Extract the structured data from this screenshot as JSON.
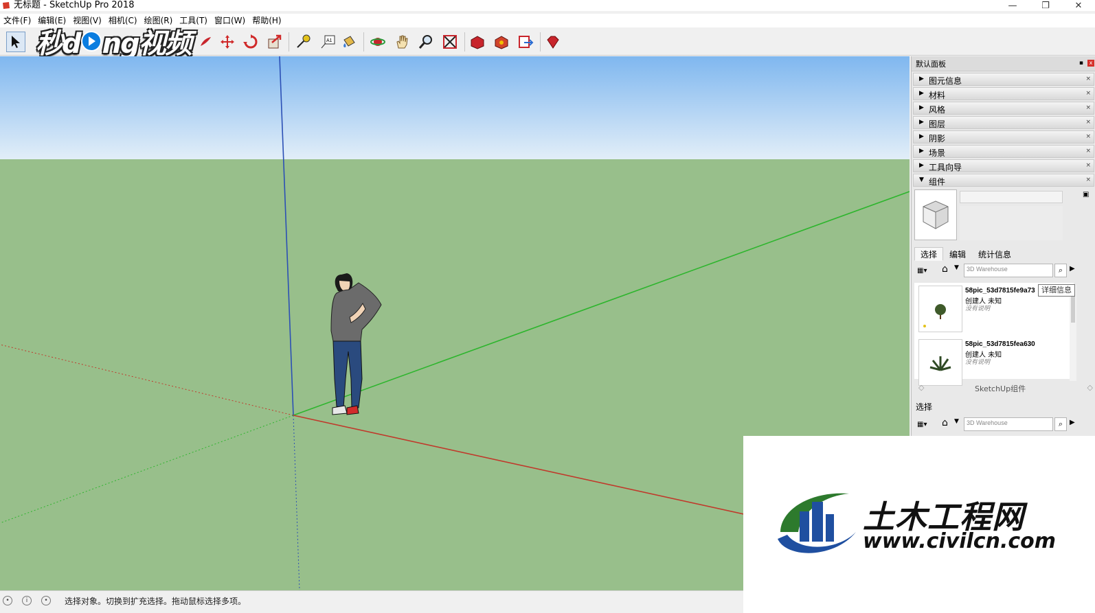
{
  "window": {
    "title": "无标题 - SketchUp Pro 2018",
    "min_glyph": "—",
    "restore_glyph": "❐",
    "close_glyph": "✕"
  },
  "menu": [
    "文件(F)",
    "编辑(E)",
    "视图(V)",
    "相机(C)",
    "绘图(R)",
    "工具(T)",
    "窗口(W)",
    "帮助(H)"
  ],
  "watermark_top": {
    "part1": "秒d",
    "part2": "ng视频"
  },
  "toolbar_icons": [
    "select-icon",
    "paint-icon",
    "move-icon",
    "rotate-icon",
    "push-pull-icon",
    "tape-measure-icon",
    "text-icon",
    "paint-bucket-icon",
    "orbit-icon",
    "pan-icon",
    "zoom-icon",
    "zoom-extents-icon",
    "warehouse-icon",
    "extension-warehouse-icon",
    "send-to-layout-icon",
    "ruby-icon"
  ],
  "panel": {
    "title": "默认面板",
    "trays": [
      {
        "label": "图元信息",
        "expanded": false
      },
      {
        "label": "材料",
        "expanded": false
      },
      {
        "label": "风格",
        "expanded": false
      },
      {
        "label": "图层",
        "expanded": false
      },
      {
        "label": "阴影",
        "expanded": false
      },
      {
        "label": "场景",
        "expanded": false
      },
      {
        "label": "工具向导",
        "expanded": false
      },
      {
        "label": "组件",
        "expanded": true
      }
    ],
    "tabs": [
      "选择",
      "编辑",
      "统计信息"
    ],
    "search_placeholder": "3D Warehouse",
    "tooltip": "详细信息",
    "results": [
      {
        "name": "58pic_53d7815fe9a73",
        "author": "创建人 未知",
        "desc": "没有说明"
      },
      {
        "name": "58pic_53d7815fea630",
        "author": "创建人 未知",
        "desc": "没有说明"
      }
    ],
    "nav_label": "SketchUp组件",
    "section2_title": "选择",
    "search2_placeholder": "3D Warehouse"
  },
  "status": {
    "text": "选择对象。切换到扩充选择。拖动鼠标选择多项。"
  },
  "watermark_box": {
    "cn": "土木工程网",
    "url": "www.civilcn.com"
  },
  "colors": {
    "sky_top": "#7fb7ef",
    "sky_bottom": "#e2eef8",
    "ground": "#98bf8b",
    "axis_blue": "#2b4fb5",
    "axis_green": "#2db52d",
    "axis_red": "#c0392b"
  }
}
